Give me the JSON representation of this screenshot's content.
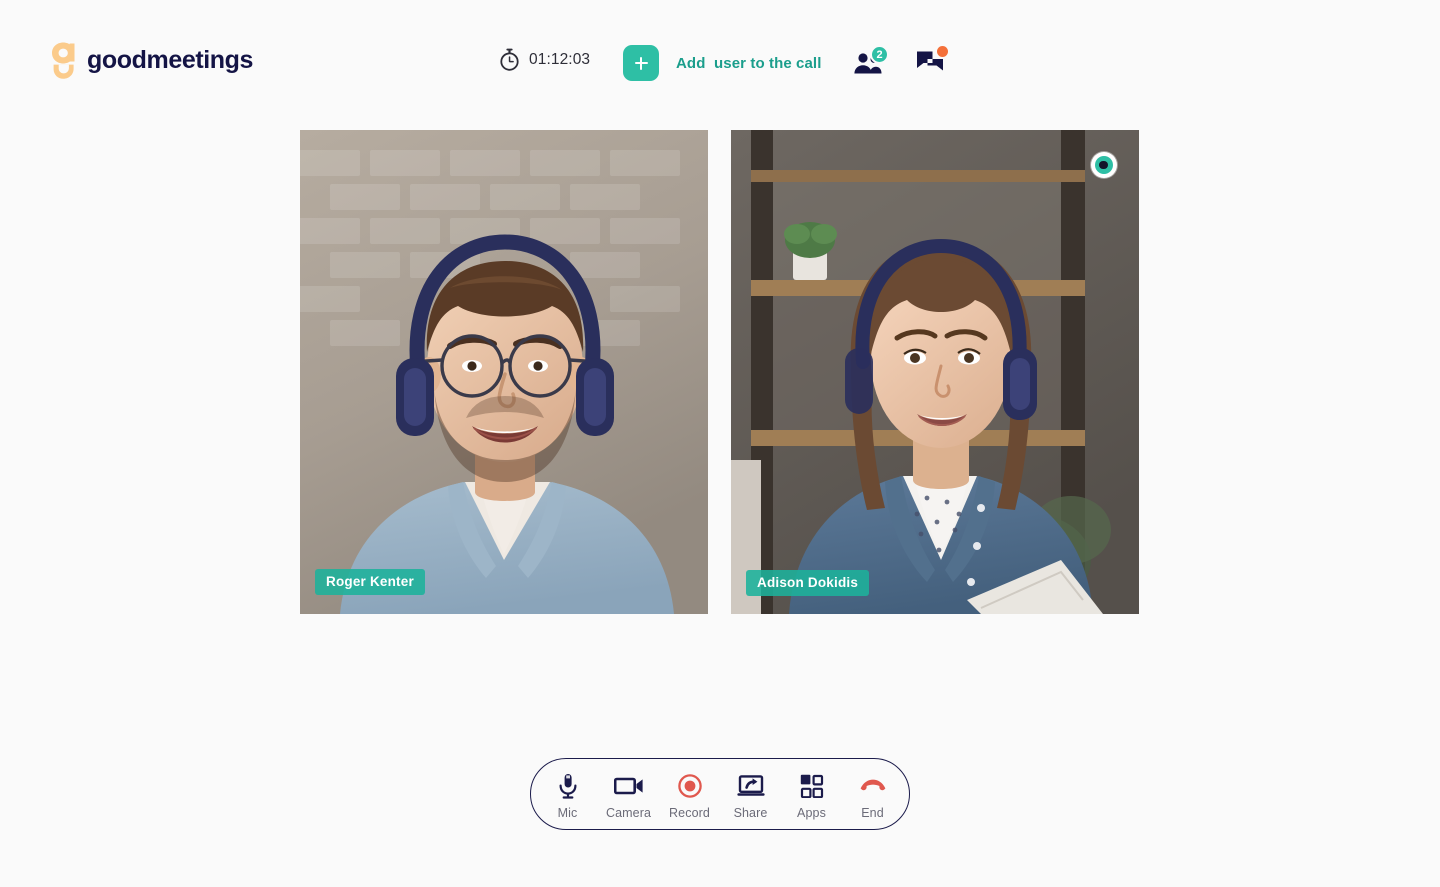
{
  "app": {
    "name": "goodmeetings",
    "background_color": "#FAFAFA",
    "accent_color": "#2EBFA5",
    "dark_color": "#141445",
    "danger_color": "#E0584E",
    "logo_mark_color": "#FBCB8B"
  },
  "header": {
    "logo_text": "goodmeetings",
    "timer": {
      "icon": "stopwatch-icon",
      "value": "01:12:03"
    },
    "add_user": {
      "icon": "plus-icon",
      "label": "Add  user to the call"
    },
    "participants": {
      "icon": "people-icon",
      "badge": "2",
      "badge_color": "#2EBFA5"
    },
    "chat": {
      "icon": "chat-icon",
      "badge_dot": true,
      "badge_color": "#F4703A"
    }
  },
  "stage": {
    "tiles": [
      {
        "name": "Roger Kenter",
        "spotlighted": false
      },
      {
        "name": "Adison Dokidis",
        "spotlighted": true,
        "spotlight_icon": "eye-icon"
      }
    ]
  },
  "toolbar": {
    "items": [
      {
        "label": "Mic",
        "icon": "microphone-icon",
        "color": "#1B1B4B"
      },
      {
        "label": "Camera",
        "icon": "video-camera-icon",
        "color": "#1B1B4B"
      },
      {
        "label": "Record",
        "icon": "record-icon",
        "color": "#E0584E"
      },
      {
        "label": "Share",
        "icon": "screen-share-icon",
        "color": "#1B1B4B"
      },
      {
        "label": "Apps",
        "icon": "apps-grid-icon",
        "color": "#1B1B4B"
      },
      {
        "label": "End",
        "icon": "hangup-phone-icon",
        "color": "#E0584E"
      }
    ]
  }
}
